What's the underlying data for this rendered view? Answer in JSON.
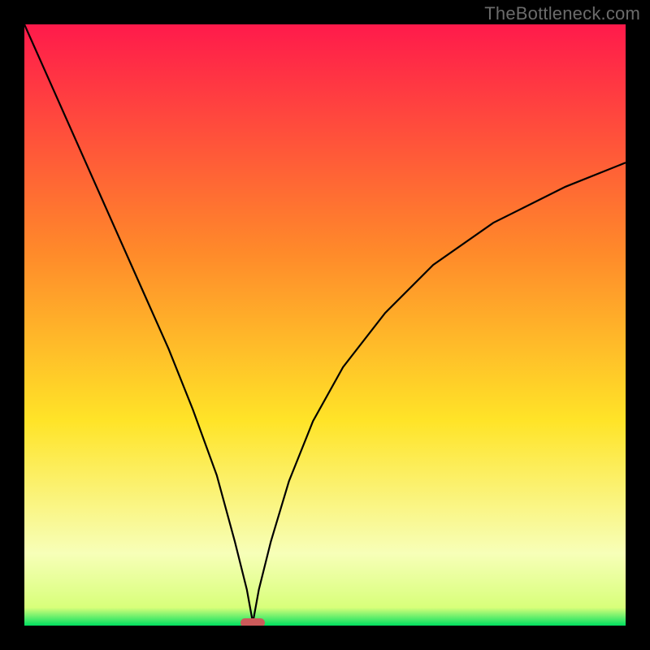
{
  "attribution": "TheBottleneck.com",
  "colors": {
    "top": "#ff1a4b",
    "orange": "#ff8a2a",
    "yellow": "#ffe428",
    "pale": "#f7ffb8",
    "green": "#00e060",
    "curve": "#000000",
    "marker": "#cc5a5a",
    "frame": "#000000"
  },
  "chart_data": {
    "type": "line",
    "title": "",
    "xlabel": "",
    "ylabel": "",
    "xlim": [
      0,
      100
    ],
    "ylim": [
      0,
      100
    ],
    "min_x": 38,
    "series": [
      {
        "name": "curve",
        "x": [
          0,
          4,
          8,
          12,
          16,
          20,
          24,
          28,
          32,
          35,
          37,
          38,
          39,
          41,
          44,
          48,
          53,
          60,
          68,
          78,
          90,
          100
        ],
        "values": [
          100,
          91,
          82,
          73,
          64,
          55,
          46,
          36,
          25,
          14,
          6,
          0.5,
          6,
          14,
          24,
          34,
          43,
          52,
          60,
          67,
          73,
          77
        ]
      }
    ],
    "marker": {
      "x": 38,
      "y": 0.5,
      "w": 4,
      "h": 1.5
    }
  }
}
